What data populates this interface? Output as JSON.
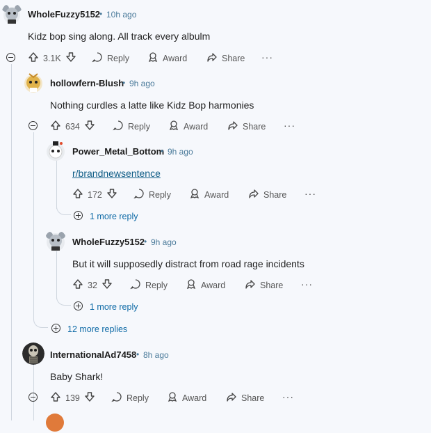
{
  "actions": {
    "reply": "Reply",
    "award": "Award",
    "share": "Share",
    "more": "···"
  },
  "comments": [
    {
      "user": "WholeFuzzy5152",
      "time": "10h ago",
      "text": "Kidz bop sing along. All track every albulm",
      "votes": "3.1K"
    },
    {
      "user": "hollowfern-Blush",
      "time": "9h ago",
      "text": "Nothing curdles a latte like Kidz Bop harmonies",
      "votes": "634"
    },
    {
      "user": "Power_Metal_Bottom",
      "time": "9h ago",
      "text": "r/brandnewsentence",
      "votes": "172",
      "more_replies": "1 more reply"
    },
    {
      "user": "WholeFuzzy5152",
      "time": "9h ago",
      "text": "But it will supposedly distract from road rage incidents",
      "votes": "32",
      "more_replies": "1 more reply"
    },
    {
      "user": "InternationalAd7458",
      "time": "8h ago",
      "text": "Baby Shark!",
      "votes": "139"
    }
  ],
  "more_replies_level2": "12 more replies",
  "colors": {
    "background": "#f6f8fc",
    "link": "#0e6aa6",
    "time": "#4a7a9a",
    "thread": "#cfd6df"
  }
}
